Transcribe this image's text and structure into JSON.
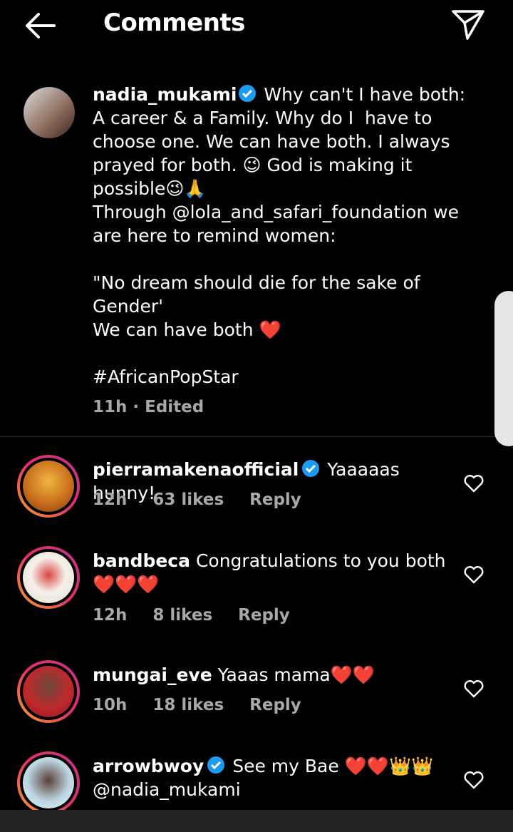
{
  "header": {
    "title": "Comments"
  },
  "caption": {
    "username": "nadia_mukami",
    "text": " Why can't I have both:\nA career & a Family. Why do I  have to choose one. We can have both. I always prayed for both. 😉 God is making it possible😉🙏\nThrough @lola_and_safari_foundation we are here to remind women:\n\n\"No dream should die for the sake of Gender'\nWe can have both ❤️\n\n#AfricanPopStar",
    "meta": "11h · Edited"
  },
  "comments": [
    {
      "username": "pierramakenaofficial",
      "verified": true,
      "text": " Yaaaaas hunny!",
      "time": "12h",
      "likes": "63 likes",
      "reply": "Reply"
    },
    {
      "username": "bandbeca",
      "verified": false,
      "text": " Congratulations to you both ❤️❤️❤️",
      "time": "12h",
      "likes": "8 likes",
      "reply": "Reply"
    },
    {
      "username": "mungai_eve",
      "verified": false,
      "text": " Yaaas mama❤️❤️",
      "time": "10h",
      "likes": "18 likes",
      "reply": "Reply"
    },
    {
      "username": "arrowbwoy",
      "verified": true,
      "text": " See my Bae ❤️❤️👑👑 @nadia_mukami",
      "time": "",
      "likes": "",
      "reply": ""
    }
  ],
  "icons": {
    "back": "arrow-left-icon",
    "share": "paper-plane-icon",
    "verified": "verified-badge-icon",
    "like": "heart-outline-icon"
  },
  "colors": {
    "background": "#000000",
    "verified": "#1d9bf0",
    "meta": "#a8a8a8"
  }
}
